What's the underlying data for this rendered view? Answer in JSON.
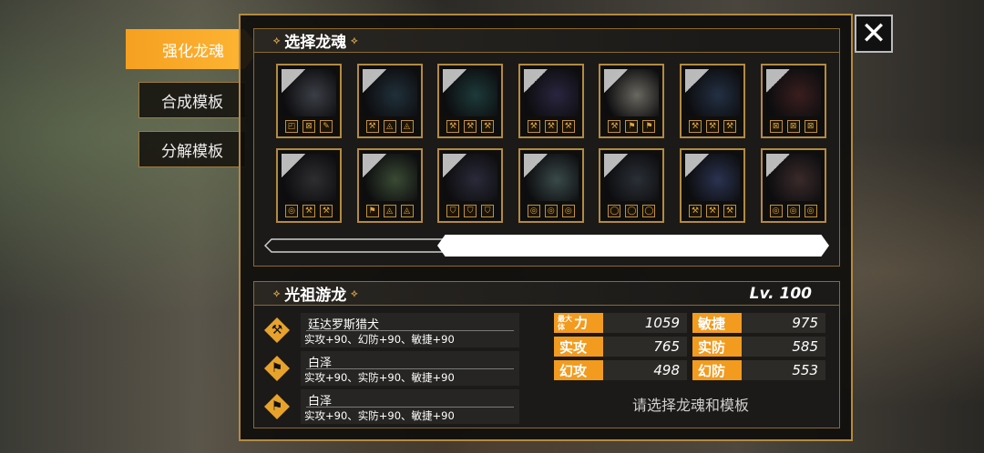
{
  "side_menu": [
    {
      "label": "强化龙魂",
      "active": true
    },
    {
      "label": "合成模板",
      "active": false
    },
    {
      "label": "分解模板",
      "active": false
    }
  ],
  "close_label": "✕",
  "select_panel": {
    "title": "选择龙魂"
  },
  "cards": [
    {
      "icons": [
        "◰",
        "⊠",
        "✎"
      ]
    },
    {
      "icons": [
        "⚒",
        "◬",
        "◬"
      ]
    },
    {
      "icons": [
        "⚒",
        "⚒",
        "⚒"
      ]
    },
    {
      "icons": [
        "⚒",
        "⚒",
        "⚒"
      ]
    },
    {
      "icons": [
        "⚒",
        "⚑",
        "⚑"
      ]
    },
    {
      "icons": [
        "⚒",
        "⚒",
        "⚒"
      ]
    },
    {
      "icons": [
        "⊠",
        "⊠",
        "⊠"
      ]
    },
    {
      "icons": [
        "◎",
        "⚒",
        "⚒"
      ]
    },
    {
      "icons": [
        "⚑",
        "◬",
        "◬"
      ]
    },
    {
      "icons": [
        "⛉",
        "⛉",
        "⛉"
      ]
    },
    {
      "icons": [
        "◎",
        "◎",
        "◎"
      ]
    },
    {
      "icons": [
        "◯",
        "◯",
        "◯"
      ]
    },
    {
      "icons": [
        "⚒",
        "⚒",
        "⚒"
      ]
    },
    {
      "icons": [
        "◎",
        "◎",
        "◎"
      ]
    }
  ],
  "detail": {
    "title": "光祖游龙",
    "level": "Lv. 100",
    "modules": [
      {
        "name": "廷达罗斯猎犬",
        "stats": "实攻+90、幻防+90、敏捷+90"
      },
      {
        "name": "白泽",
        "stats": "实攻+90、实防+90、敏捷+90"
      },
      {
        "name": "白泽",
        "stats": "实攻+90、实防+90、敏捷+90"
      }
    ],
    "stats": {
      "hp_label_small": "最大\n体",
      "hp_label_big": "力",
      "hp": "1059",
      "agi_label": "敏捷",
      "agi": "975",
      "patk_label": "实攻",
      "patk": "765",
      "pdef_label": "实防",
      "pdef": "585",
      "matk_label": "幻攻",
      "matk": "498",
      "mdef_label": "幻防",
      "mdef": "553"
    },
    "hint": "请选择龙魂和模板"
  },
  "colors": {
    "accent": "#f29b1f",
    "border": "#b58a3f"
  }
}
